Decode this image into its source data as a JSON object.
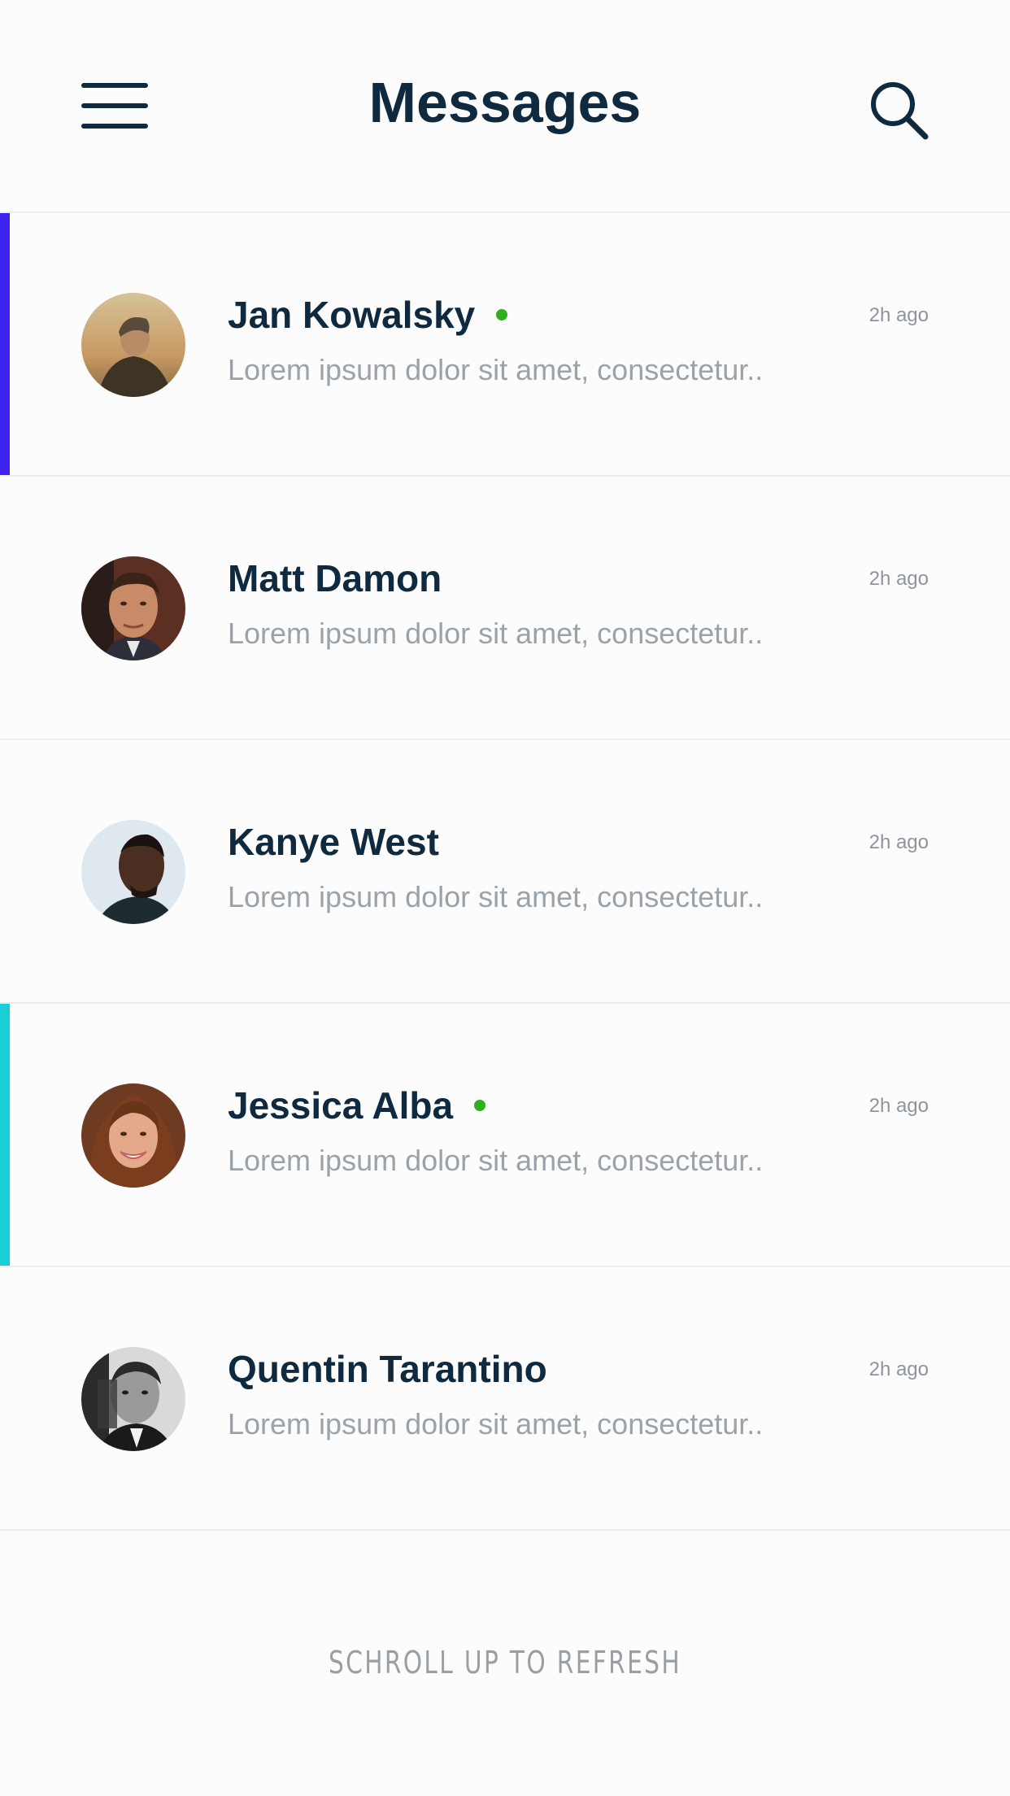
{
  "header": {
    "title": "Messages",
    "menu_icon": "hamburger-menu-icon",
    "search_icon": "search-icon"
  },
  "messages": [
    {
      "name": "Jan Kowalsky",
      "preview": "Lorem ipsum dolor sit amet, consectetur..",
      "time": "2h ago",
      "online": true,
      "accent": "#3d22f2",
      "avatar": "avatar-man-sunset"
    },
    {
      "name": "Matt Damon",
      "preview": "Lorem ipsum dolor sit amet, consectetur..",
      "time": "2h ago",
      "online": false,
      "accent": null,
      "avatar": "avatar-matt-damon"
    },
    {
      "name": "Kanye West",
      "preview": "Lorem ipsum dolor sit amet, consectetur..",
      "time": "2h ago",
      "online": false,
      "accent": null,
      "avatar": "avatar-kanye-west"
    },
    {
      "name": "Jessica Alba",
      "preview": "Lorem ipsum dolor sit amet, consectetur..",
      "time": "2h ago",
      "online": true,
      "accent": "#19cfd6",
      "avatar": "avatar-jessica-alba"
    },
    {
      "name": "Quentin Tarantino",
      "preview": "Lorem ipsum dolor sit amet, consectetur..",
      "time": "2h ago",
      "online": false,
      "accent": null,
      "avatar": "avatar-quentin-tarantino"
    }
  ],
  "footer": {
    "refresh_hint": "SCHROLL UP TO REFRESH"
  },
  "colors": {
    "text_dark": "#0f2a3f",
    "text_muted": "#9aa3aa",
    "online": "#2fae1f"
  }
}
